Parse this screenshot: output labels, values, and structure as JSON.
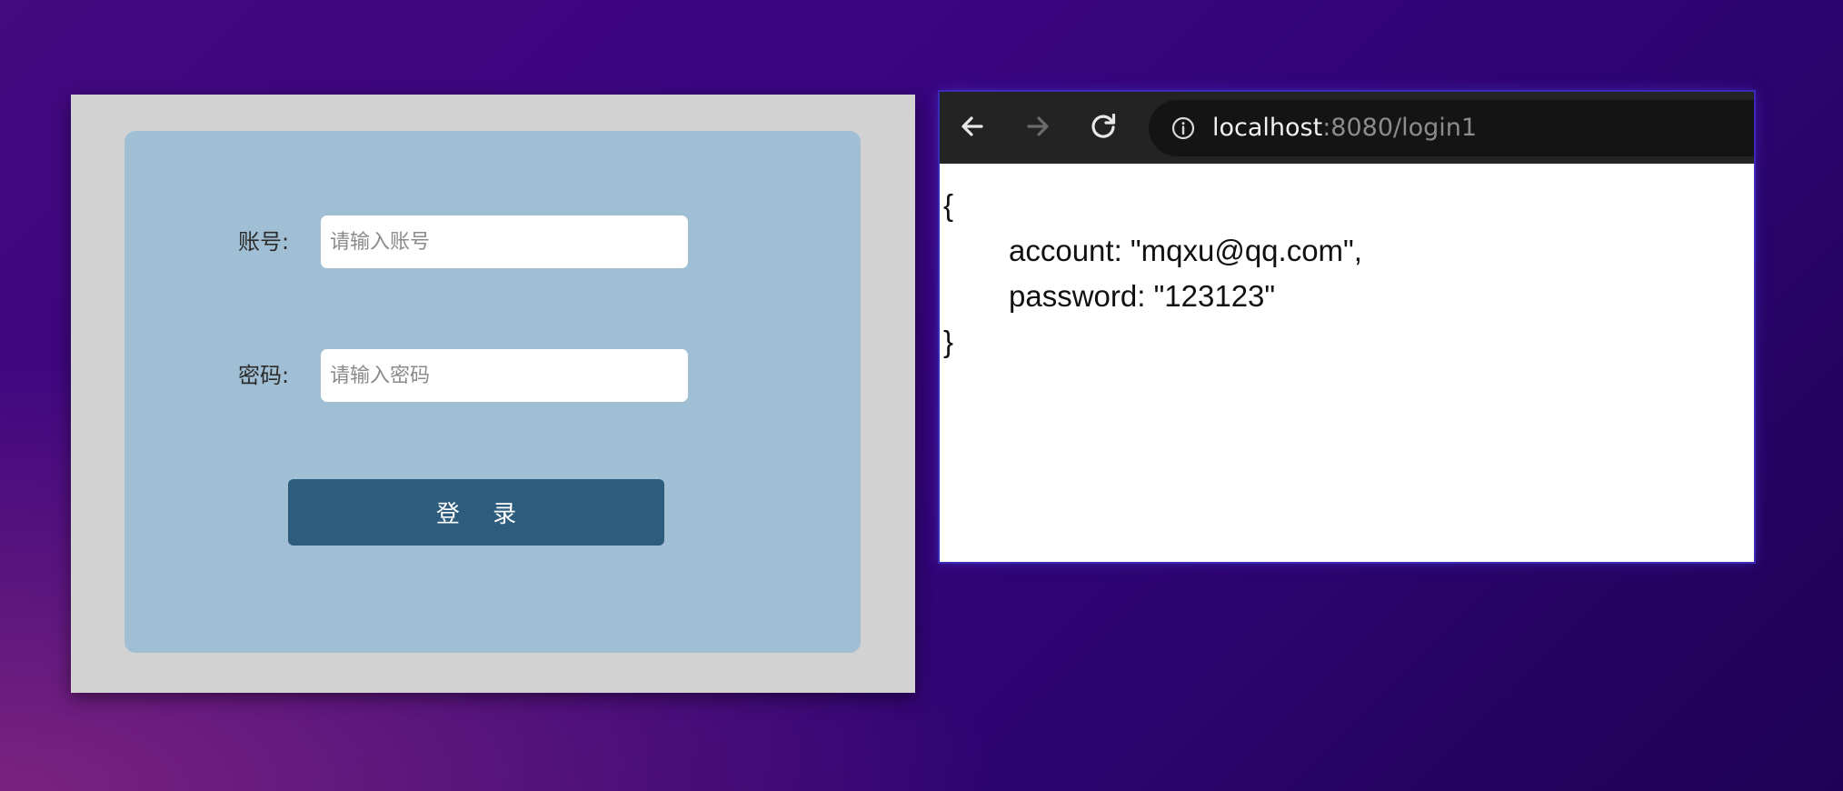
{
  "login_form": {
    "account_label": "账号:",
    "account_placeholder": "请输入账号",
    "account_value": "",
    "password_label": "密码:",
    "password_placeholder": "请输入密码",
    "password_value": "",
    "submit_label": "登 录"
  },
  "browser": {
    "url_host": "localhost",
    "url_path": ":8080/login1",
    "icons": {
      "back": "back-arrow-icon",
      "forward": "forward-arrow-icon",
      "reload": "reload-icon",
      "info": "info-icon"
    },
    "response_lines": [
      "{",
      "account: \"mqxu@qq.com\",",
      "password: \"123123\"",
      "}"
    ]
  },
  "colors": {
    "login_card": "#a1bfd4",
    "login_button": "#2e5c7d",
    "toolbar": "#232323"
  }
}
